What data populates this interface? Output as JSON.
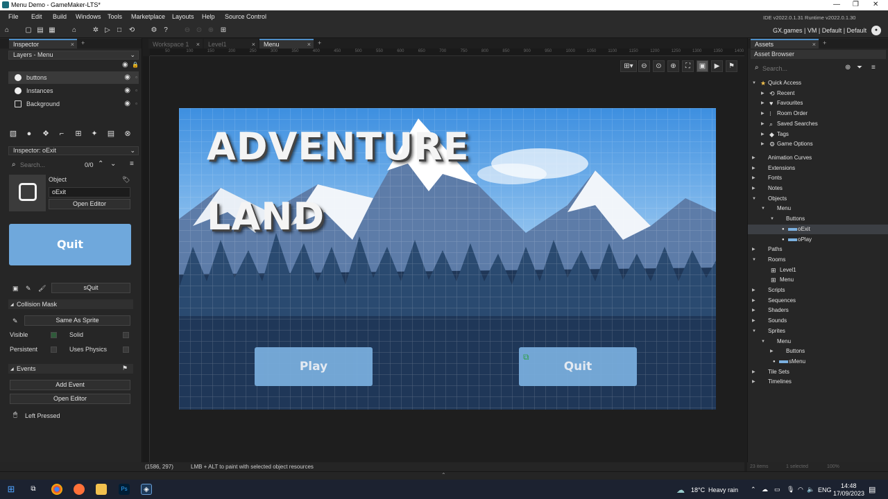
{
  "window": {
    "title": "Menu Demo - GameMaker-LTS*"
  },
  "menu": [
    "File",
    "Edit",
    "Build",
    "Windows",
    "Tools",
    "Marketplace",
    "Layouts",
    "Help",
    "Source Control"
  ],
  "toolbar_right": {
    "version": "IDE v2022.0.1.31  Runtime v2022.0.1.30",
    "target": "GX.games | VM | Default | Default"
  },
  "inspector": {
    "tab": "Inspector",
    "layers_header": "Layers - Menu",
    "layers": [
      "buttons",
      "Instances",
      "Background"
    ],
    "inspector_header": "Inspector: oExit",
    "search_placeholder": "Search...",
    "search_count": "0/0",
    "object_label": "Object",
    "object_name": "oExit",
    "open_editor": "Open Editor",
    "sprite_preview_text": "Quit",
    "sprite_name": "sQuit",
    "collision_mask_label": "Collision Mask",
    "collision_mask_value": "Same As Sprite",
    "visible_label": "Visible",
    "solid_label": "Solid",
    "persistent_label": "Persistent",
    "uses_physics_label": "Uses Physics",
    "events_label": "Events",
    "add_event": "Add Event",
    "open_editor2": "Open Editor",
    "event_item": "Left Pressed"
  },
  "editor": {
    "tabs": [
      "Workspace 1",
      "Level1",
      "Menu"
    ],
    "ruler": [
      "50",
      "100",
      "150",
      "200",
      "250",
      "300",
      "350",
      "400",
      "450",
      "500",
      "550",
      "600",
      "650",
      "700",
      "750",
      "800",
      "850",
      "900",
      "950",
      "1000",
      "1050",
      "1100",
      "1150",
      "1200",
      "1250",
      "1300",
      "1350",
      "1400"
    ],
    "room_title_line1": "ADVENTURE",
    "room_title_line2": "LAND",
    "play_button": "Play",
    "quit_button": "Quit",
    "status_coords": "(1586, 297)",
    "status_hint": "LMB + ALT to paint with selected object resources"
  },
  "assets": {
    "tab": "Assets",
    "browser_label": "Asset Browser",
    "search_placeholder": "Search...",
    "quick_access": "Quick Access",
    "quick_items": [
      "Recent",
      "Favourites",
      "Room Order",
      "Saved Searches",
      "Tags",
      "Game Options"
    ],
    "tree": [
      "Animation Curves",
      "Extensions",
      "Fonts",
      "Notes",
      "Objects",
      "Menu",
      "Buttons",
      "oExit",
      "oPlay",
      "Paths",
      "Rooms",
      "Level1",
      "Menu",
      "Scripts",
      "Sequences",
      "Shaders",
      "Sounds",
      "Sprites",
      "Menu",
      "Buttons",
      "sMenu",
      "Tile Sets",
      "Timelines"
    ],
    "status_items": "23 items",
    "status_selected": "1 selected",
    "status_zoom": "100%"
  },
  "taskbar": {
    "weather_temp": "18°C",
    "weather_desc": "Heavy rain",
    "lang": "ENG",
    "time": "14:48",
    "date": "17/09/2023"
  },
  "colors": {
    "accent": "#4f8fc7",
    "button": "#7bb0df",
    "panel": "#262626"
  }
}
